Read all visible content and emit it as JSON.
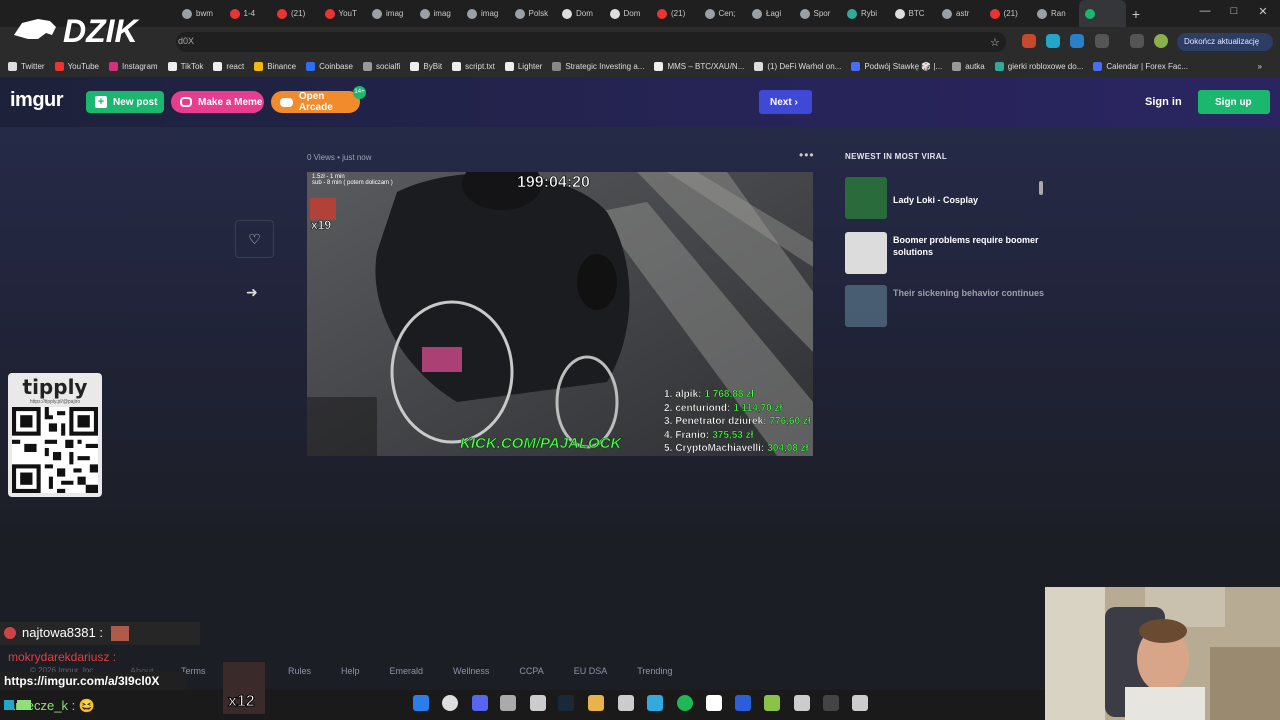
{
  "browser": {
    "tabs": [
      {
        "label": "bwm",
        "color": "#9aa0a6"
      },
      {
        "label": "1-4",
        "color": "#e33"
      },
      {
        "label": "(21)",
        "color": "#e33"
      },
      {
        "label": "YouT",
        "color": "#e33"
      },
      {
        "label": "imag",
        "color": "#9aa0a6"
      },
      {
        "label": "imag",
        "color": "#9aa0a6"
      },
      {
        "label": "imag",
        "color": "#9aa0a6"
      },
      {
        "label": "Polsk",
        "color": "#9aa0a6"
      },
      {
        "label": "Dom",
        "color": "#ddd"
      },
      {
        "label": "Dom",
        "color": "#ddd"
      },
      {
        "label": "(21)",
        "color": "#e33"
      },
      {
        "label": "Cen;",
        "color": "#9aa0a6"
      },
      {
        "label": "Łagi",
        "color": "#9aa0a6"
      },
      {
        "label": "Spor",
        "color": "#9aa0a6"
      },
      {
        "label": "Rybi",
        "color": "#3a9"
      },
      {
        "label": "BTC",
        "color": "#ddd"
      },
      {
        "label": "astr",
        "color": "#9aa0a6"
      },
      {
        "label": "(21)",
        "color": "#e33"
      },
      {
        "label": "Ran",
        "color": "#9aa0a6"
      },
      {
        "label": "",
        "color": "#1bb76e"
      }
    ],
    "url": "d0X",
    "update_label": "Dokończ aktualizację",
    "bookmarks": [
      {
        "label": "Twitter",
        "color": "#ddd"
      },
      {
        "label": "YouTube",
        "color": "#e33"
      },
      {
        "label": "Instagram",
        "color": "#d6307a"
      },
      {
        "label": "TikTok",
        "color": "#eee"
      },
      {
        "label": "react",
        "color": "#eee"
      },
      {
        "label": "Binance",
        "color": "#f0b90b"
      },
      {
        "label": "Coinbase",
        "color": "#2e6ef7"
      },
      {
        "label": "socialfi",
        "color": "#999"
      },
      {
        "label": "ByBit",
        "color": "#eee"
      },
      {
        "label": "script.txt",
        "color": "#eee"
      },
      {
        "label": "Lighter",
        "color": "#eee"
      },
      {
        "label": "Strategic Investing a...",
        "color": "#888"
      },
      {
        "label": "MMS – BTC/XAU/N...",
        "color": "#eee"
      },
      {
        "label": "(1) DeFi Warhol on...",
        "color": "#ddd"
      },
      {
        "label": "Podwój Stawkę 🎲 |...",
        "color": "#4a6cf7"
      },
      {
        "label": "autka",
        "color": "#999"
      },
      {
        "label": "gierki robloxowe do...",
        "color": "#3a9"
      },
      {
        "label": "Calendar | Forex Fac...",
        "color": "#4a6cf7"
      }
    ]
  },
  "overlay": {
    "dzik_logo": "DZIK",
    "tipply_brand": "tipply",
    "tipply_url": "https://tipply.pl/@pajiro"
  },
  "header": {
    "logo": "imgur",
    "new_post": "New post",
    "make_meme": "Make a Meme",
    "open_arcade": "Open Arcade",
    "arcade_badge": "14+",
    "next": "Next",
    "sign_in": "Sign in",
    "sign_up": "Sign up"
  },
  "post": {
    "views": "0 Views",
    "time": "just now",
    "stream": {
      "timer": "199:04:20",
      "info_line1": "1.5zł - 1 min",
      "info_line2": "sub - 8 min ( potem doliczam )",
      "multiplier": "x19",
      "kick_url": "KICK.COM/PAJALOCK",
      "leaderboard": [
        {
          "rank": "1.",
          "name": "alpik:",
          "amount": "1 768,88 zł"
        },
        {
          "rank": "2.",
          "name": "centuriond:",
          "amount": "1 114,70 zł"
        },
        {
          "rank": "3.",
          "name": "Penetrator dziurek:",
          "amount": "776,60 zł"
        },
        {
          "rank": "4.",
          "name": "Franio:",
          "amount": "375,53 zł"
        },
        {
          "rank": "5.",
          "name": "CryptoMachiavelli:",
          "amount": "304,08 zł"
        }
      ]
    }
  },
  "sidebar": {
    "title": "NEWEST IN MOST VIRAL",
    "items": [
      {
        "title": "Lady Loki - Cosplay",
        "color": "#2a6b3c"
      },
      {
        "title": "Boomer problems require boomer solutions",
        "color": "#dcdcdc"
      },
      {
        "title": "Their sickening behavior continues",
        "color": "#6a8aa0"
      }
    ]
  },
  "footer": {
    "copyright": "© 2026 Imgur, Inc",
    "about": "About",
    "terms": "Terms",
    "links": [
      "Rules",
      "Help",
      "Emerald",
      "Wellness",
      "CCPA",
      "EU DSA",
      "Trending"
    ]
  },
  "chat": {
    "msg1_user": "najtowa8381 :",
    "msg2_user": "mokrydarekdariusz :",
    "msg3_user": "areecze_k :",
    "multiplier": "x12"
  },
  "status_url": "https://imgur.com/a/3I9cl0X"
}
